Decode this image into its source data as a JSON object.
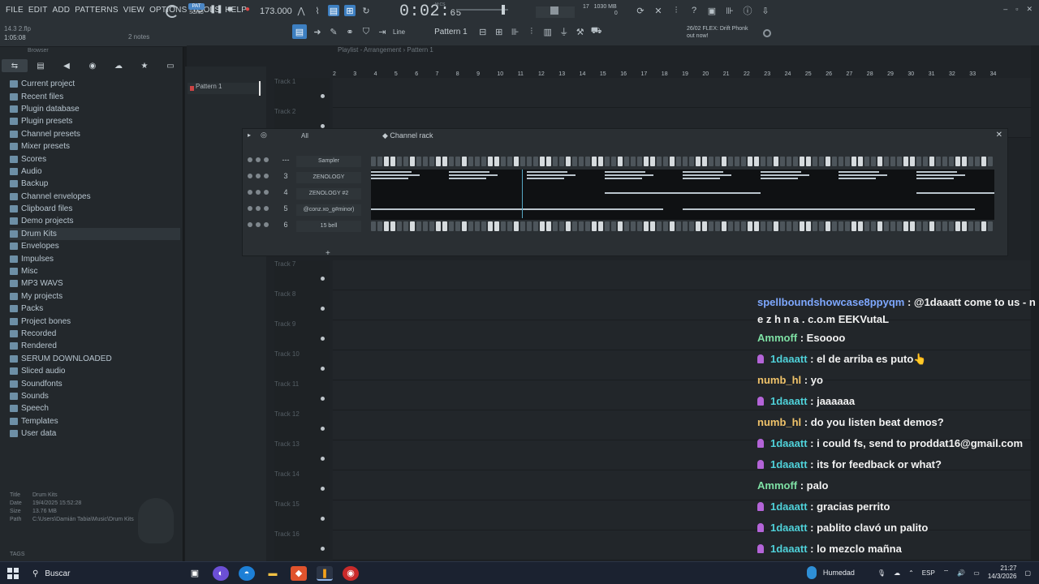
{
  "menu": [
    "FILE",
    "EDIT",
    "ADD",
    "PATTERNS",
    "VIEW",
    "OPTIONS",
    "TOOLS",
    "HELP"
  ],
  "project": {
    "name": "14.3 2.flp",
    "time": "1:05:08",
    "notes": "2 notes"
  },
  "transport": {
    "pat": "PAT",
    "song": "SONG",
    "tempo": "173.000",
    "time_main": "0:02",
    "time_sub": "65",
    "mcs": "M:CS"
  },
  "cpu": {
    "value": "17",
    "mem": "1030 MB",
    "poly": "0"
  },
  "hint": {
    "date": "26/02",
    "line1": "FLEX: Drift Phonk",
    "line2": "out now!"
  },
  "toolbar2": {
    "line": "Line",
    "pattern": "Pattern 1"
  },
  "browser": {
    "title": "Browser",
    "items": [
      "Current project",
      "Recent files",
      "Plugin database",
      "Plugin presets",
      "Channel presets",
      "Mixer presets",
      "Scores",
      "Audio",
      "Backup",
      "Channel envelopes",
      "Clipboard files",
      "Demo projects",
      "Drum Kits",
      "Envelopes",
      "Impulses",
      "Misc",
      "MP3 WAVS",
      "My projects",
      "Packs",
      "Project bones",
      "Recorded",
      "Rendered",
      "SERUM DOWNLOADED",
      "Sliced audio",
      "Soundfonts",
      "Sounds",
      "Speech",
      "Templates",
      "User data"
    ],
    "selected": "Drum Kits",
    "info": {
      "title_k": "Title",
      "title_v": "Drum Kits",
      "date_k": "Date",
      "date_v": "19/4/2025 15:52:28",
      "size_k": "Size",
      "size_v": "13.76 MB",
      "path_k": "Path",
      "path_v": "C:\\Users\\Damián Tabia\\Music\\Drum Kits"
    },
    "tags": "TAGS"
  },
  "playlist": {
    "title": "Playlist - Arrangement › Pattern 1",
    "pattern": "Pattern 1",
    "ruler": [
      "2",
      "3",
      "4",
      "5",
      "6",
      "7",
      "8",
      "9",
      "10",
      "11",
      "12",
      "13",
      "14",
      "15",
      "16",
      "17",
      "18",
      "19",
      "20",
      "21",
      "22",
      "23",
      "24",
      "25",
      "26",
      "27",
      "28",
      "29",
      "30",
      "31",
      "32",
      "33",
      "34"
    ],
    "tracks": [
      "Track 1",
      "Track 2",
      "Track 7",
      "Track 8",
      "Track 9",
      "Track 10",
      "Track 11",
      "Track 12",
      "Track 13",
      "Track 14",
      "Track 15",
      "Track 16"
    ]
  },
  "channel_rack": {
    "title": "Channel rack",
    "filter": "All",
    "channels": [
      {
        "num": "---",
        "name": "Sampler"
      },
      {
        "num": "3",
        "name": "ZENOLOGY"
      },
      {
        "num": "4",
        "name": "ZENOLOGY #2"
      },
      {
        "num": "5",
        "name": "@conz.xo_g#minor)"
      },
      {
        "num": "6",
        "name": "15 bell"
      }
    ],
    "add": "+"
  },
  "chat": [
    {
      "user": "spellboundshowcase8ppyqm",
      "color": "#7ea8ff",
      "text": "@1daaatt come to us - n e z h n a . c.o.m EEKVutaL",
      "badge": false,
      "wrap": true
    },
    {
      "user": "Ammoff",
      "color": "#7ee0a4",
      "text": "Esoooo",
      "badge": false
    },
    {
      "user": "1daaatt",
      "color": "#4fd1d9",
      "text": "el de arriba es puto👆",
      "badge": true
    },
    {
      "user": "numb_hl",
      "color": "#f0c36a",
      "text": "yo",
      "badge": false
    },
    {
      "user": "1daaatt",
      "color": "#4fd1d9",
      "text": "jaaaaaa",
      "badge": true
    },
    {
      "user": "numb_hl",
      "color": "#f0c36a",
      "text": "do you listen beat demos?",
      "badge": false
    },
    {
      "user": "1daaatt",
      "color": "#4fd1d9",
      "text": "i could fs, send to proddat16@gmail.com",
      "badge": true
    },
    {
      "user": "1daaatt",
      "color": "#4fd1d9",
      "text": "its for feedback or what?",
      "badge": true
    },
    {
      "user": "Ammoff",
      "color": "#7ee0a4",
      "text": "palo",
      "badge": false
    },
    {
      "user": "1daaatt",
      "color": "#4fd1d9",
      "text": "gracias perrito",
      "badge": true
    },
    {
      "user": "1daaatt",
      "color": "#4fd1d9",
      "text": "pablito clavó un palito",
      "badge": true
    },
    {
      "user": "1daaatt",
      "color": "#4fd1d9",
      "text": "lo mezclo mañna",
      "badge": true
    }
  ],
  "taskbar": {
    "search": "Buscar",
    "weather": "Humedad",
    "lang": "ESP",
    "time": "21:27",
    "date": "14/3/2026"
  }
}
